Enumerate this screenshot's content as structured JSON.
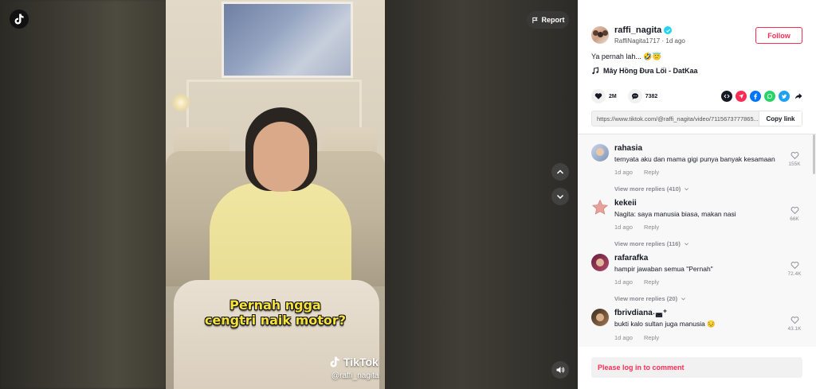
{
  "app": {
    "brand_color": "#fe2c55",
    "logo_icon": "tiktok-logo-icon"
  },
  "video": {
    "caption_line1": "Pernah ngga",
    "caption_line2": "cengtri naik motor?",
    "watermark": "TikTok",
    "watermark_handle": "@raffi_nagita"
  },
  "controls": {
    "report_label": "Report",
    "prev_icon": "chevron-up-icon",
    "next_icon": "chevron-down-icon",
    "volume_icon": "volume-icon"
  },
  "author": {
    "username": "raffi_nagita",
    "verified": true,
    "nickname": "RaffiNagita1717",
    "separator": "·",
    "posted": "1d ago",
    "follow_label": "Follow"
  },
  "post": {
    "description": "Ya pernah lah... 🤣😇",
    "music": "Mây Hồng Đưa Lối - DatKaa"
  },
  "stats": {
    "likes": "2M",
    "comments": "7382"
  },
  "share": {
    "link": "https://www.tiktok.com/@raffi_nagita/video/7115673777865...",
    "copy_label": "Copy link",
    "icons": [
      {
        "name": "embed-icon",
        "color": "#161823"
      },
      {
        "name": "send-to-friends-icon",
        "color": "#fe2c55"
      },
      {
        "name": "facebook-icon",
        "color": "#0075fa"
      },
      {
        "name": "whatsapp-icon",
        "color": "#25d366"
      },
      {
        "name": "twitter-icon",
        "color": "#1da1f2"
      },
      {
        "name": "share-arrow-icon",
        "color": "#161823"
      }
    ]
  },
  "comments": [
    {
      "user": "rahasia",
      "text": "ternyata aku dan mama gigi punya banyak kesamaan",
      "time": "1d ago",
      "reply": "Reply",
      "likes": "155K",
      "more": "View more replies (410)"
    },
    {
      "user": "kekeii",
      "text": "Nagita: saya manusia biasa, makan nasi",
      "time": "1d ago",
      "reply": "Reply",
      "likes": "66K",
      "more": "View more replies (116)"
    },
    {
      "user": "rafarafka",
      "text": "hampir jawaban semua \"Pernah\"",
      "time": "1d ago",
      "reply": "Reply",
      "likes": "72.4K",
      "more": "View more replies (20)"
    },
    {
      "user": "fbrivdiana˖◛⁺",
      "text": "bukti kalo sultan juga manusia 😔",
      "time": "1d ago",
      "reply": "Reply",
      "likes": "43.1K",
      "more": ""
    }
  ],
  "login_prompt": "Please log in to comment"
}
